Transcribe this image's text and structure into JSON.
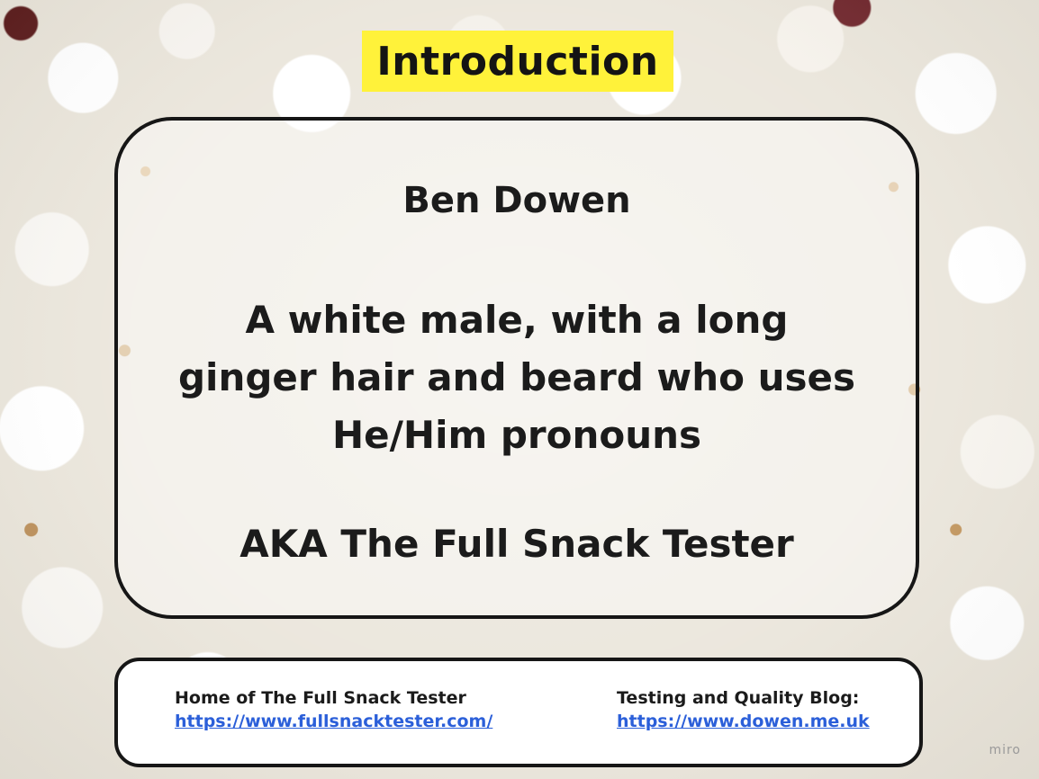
{
  "title": "Introduction",
  "main": {
    "name": "Ben Dowen",
    "description": "A white male, with a long ginger hair and beard who uses He/Him pronouns",
    "aka": "AKA The Full Snack Tester"
  },
  "footer": {
    "left": {
      "label": "Home of The Full Snack Tester",
      "link": "https://www.fullsnacktester.com/"
    },
    "right": {
      "label": "Testing and Quality Blog:",
      "link": "https://www.dowen.me.uk"
    }
  },
  "watermark": "miro",
  "colors": {
    "title_highlight": "#fff23a",
    "link": "#2b5fd9",
    "border": "#161616"
  }
}
